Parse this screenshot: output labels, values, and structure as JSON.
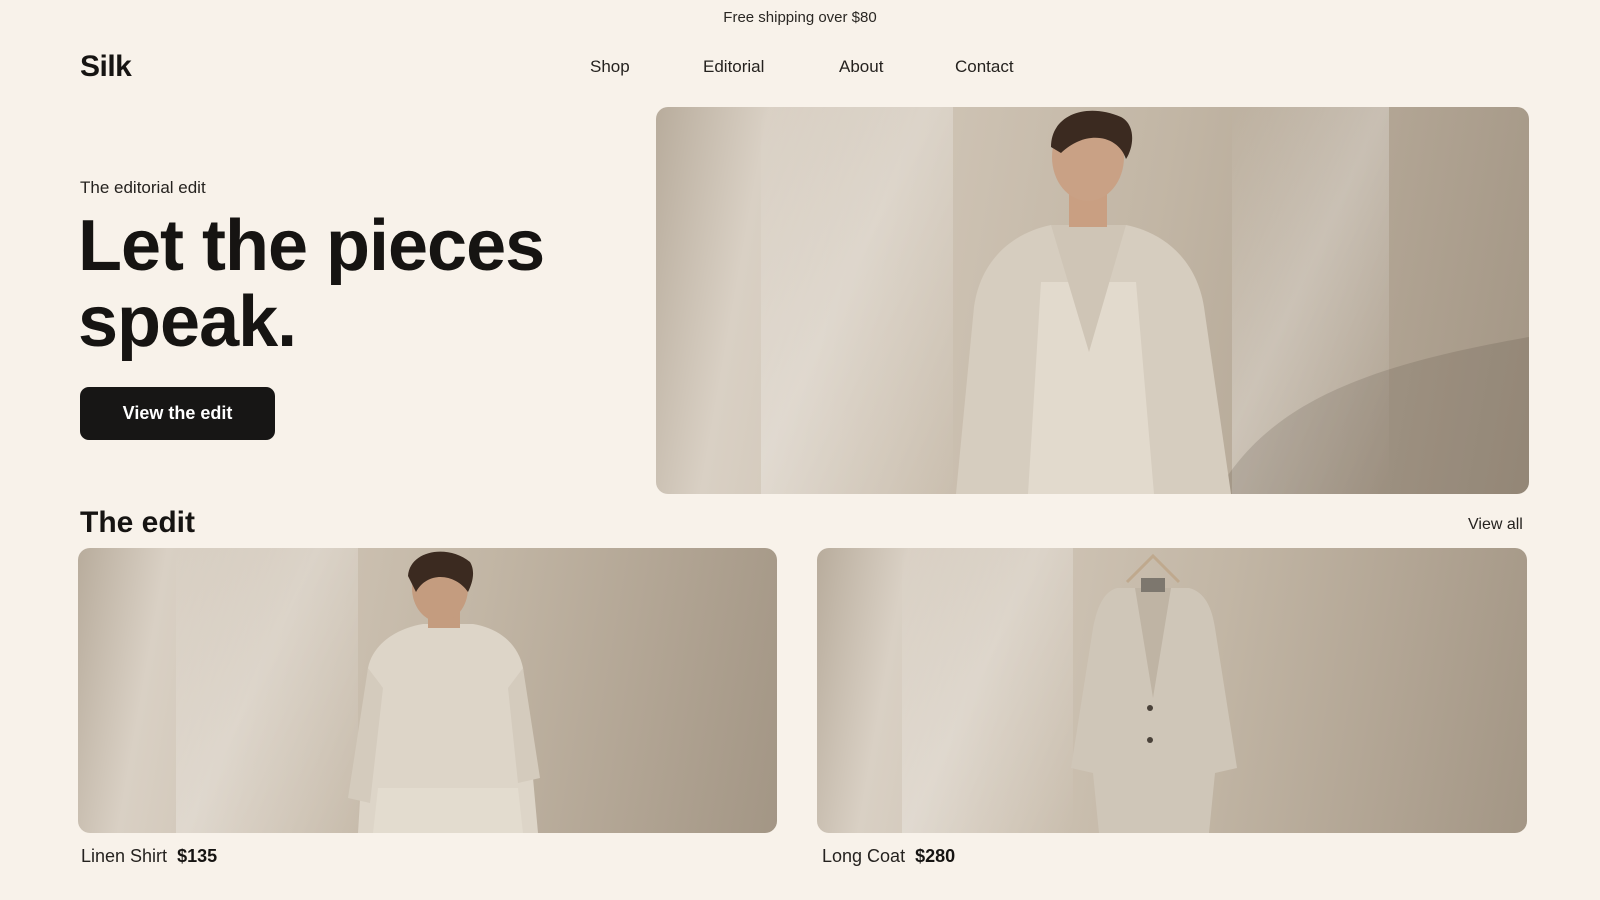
{
  "announcement": "Free shipping over $80",
  "brand": {
    "logo": "Silk"
  },
  "nav": [
    {
      "label": "Shop"
    },
    {
      "label": "Editorial"
    },
    {
      "label": "About"
    },
    {
      "label": "Contact"
    }
  ],
  "hero": {
    "eyebrow": "The editorial edit",
    "headline_line1": "Let the pieces",
    "headline_line2": "speak.",
    "cta_label": "View the edit",
    "image_alt": "Man in linen suit leaning against a sunlit wall"
  },
  "edit": {
    "title": "The edit",
    "view_all": "View all",
    "products": [
      {
        "name": "Linen Shirt",
        "price": "$135",
        "image_alt": "Man wearing linen shirt"
      },
      {
        "name": "Long Coat",
        "price": "$280",
        "image_alt": "Linen long coat on a hanger"
      }
    ]
  },
  "colors": {
    "background": "#f8f2ea",
    "text": "#161412",
    "button": "#171615",
    "button_text": "#ffffff"
  }
}
